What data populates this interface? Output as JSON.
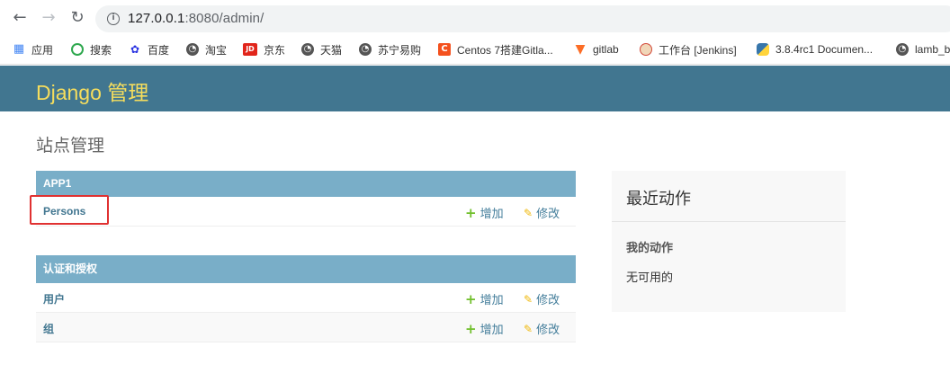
{
  "browser": {
    "url_host": "127.0.0.1",
    "url_rest": ":8080/admin/",
    "bookmarks": [
      {
        "label": "应用",
        "icon": "apps-grid-icon",
        "color": "#4285f4"
      },
      {
        "label": "搜索",
        "icon": "search-q-icon",
        "color": "#2fa84f"
      },
      {
        "label": "百度",
        "icon": "baidu-paw-icon",
        "color": "#2932e1"
      },
      {
        "label": "淘宝",
        "icon": "globe-icon",
        "color": "#555555"
      },
      {
        "label": "京东",
        "icon": "jd-icon",
        "color": "#e1251b"
      },
      {
        "label": "天猫",
        "icon": "globe-icon",
        "color": "#555555"
      },
      {
        "label": "苏宁易购",
        "icon": "globe-icon",
        "color": "#555555"
      },
      {
        "label": "Centos 7搭建Gitla...",
        "icon": "csdn-c-icon",
        "color": "#f4511e"
      },
      {
        "label": "gitlab",
        "icon": "gitlab-fox-icon",
        "color": "#fc6d26"
      },
      {
        "label": "工作台 [Jenkins]",
        "icon": "jenkins-icon",
        "color": "#d24939"
      },
      {
        "label": "3.8.4rc1 Documen...",
        "icon": "python-icon",
        "color": "#3776ab"
      },
      {
        "label": "lamb_b",
        "icon": "globe-icon",
        "color": "#555555"
      }
    ]
  },
  "header": {
    "brand": "Django 管理"
  },
  "page": {
    "title": "站点管理"
  },
  "modules": [
    {
      "caption": "APP1",
      "rows": [
        {
          "name": "Persons",
          "add": "增加",
          "change": "修改"
        }
      ]
    },
    {
      "caption": "认证和授权",
      "rows": [
        {
          "name": "用户",
          "add": "增加",
          "change": "修改"
        },
        {
          "name": "组",
          "add": "增加",
          "change": "修改"
        }
      ]
    }
  ],
  "recent": {
    "title": "最近动作",
    "subtitle": "我的动作",
    "empty": "无可用的"
  },
  "colors": {
    "header_bg": "#417690",
    "brand": "#f5dd5d",
    "caption_bg": "#79aec8",
    "link": "#447e9b",
    "add_icon": "#70bf2b",
    "change_icon": "#efb80b",
    "highlight": "#e03131"
  }
}
